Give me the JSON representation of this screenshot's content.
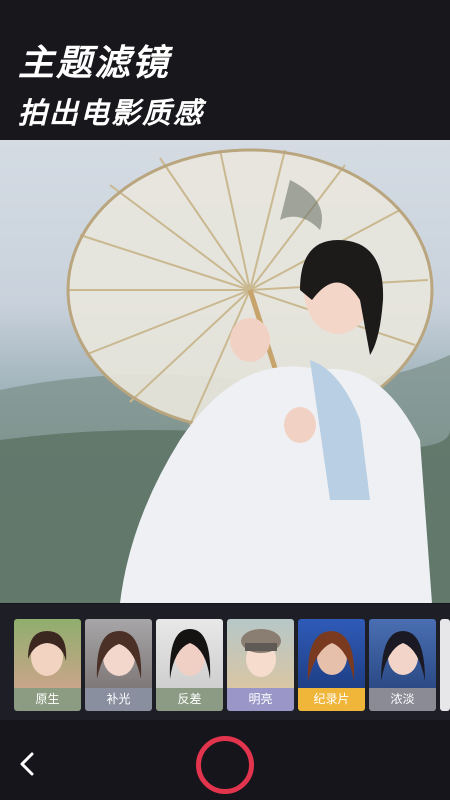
{
  "header": {
    "title": "主题滤镜",
    "subtitle": "拍出电影质感"
  },
  "filters": [
    {
      "label": "原生",
      "label_color": "#8c9c82"
    },
    {
      "label": "补光",
      "label_color": "#8a8fa0"
    },
    {
      "label": "反差",
      "label_color": "#8c9b84"
    },
    {
      "label": "明亮",
      "label_color": "#9a96c8"
    },
    {
      "label": "纪录片",
      "label_color": "#f0b63a"
    },
    {
      "label": "浓淡",
      "label_color": "#8b8b96"
    }
  ],
  "bottom_bar": {
    "back_icon": "chevron-left-icon",
    "shutter_color": "#e3344e"
  }
}
